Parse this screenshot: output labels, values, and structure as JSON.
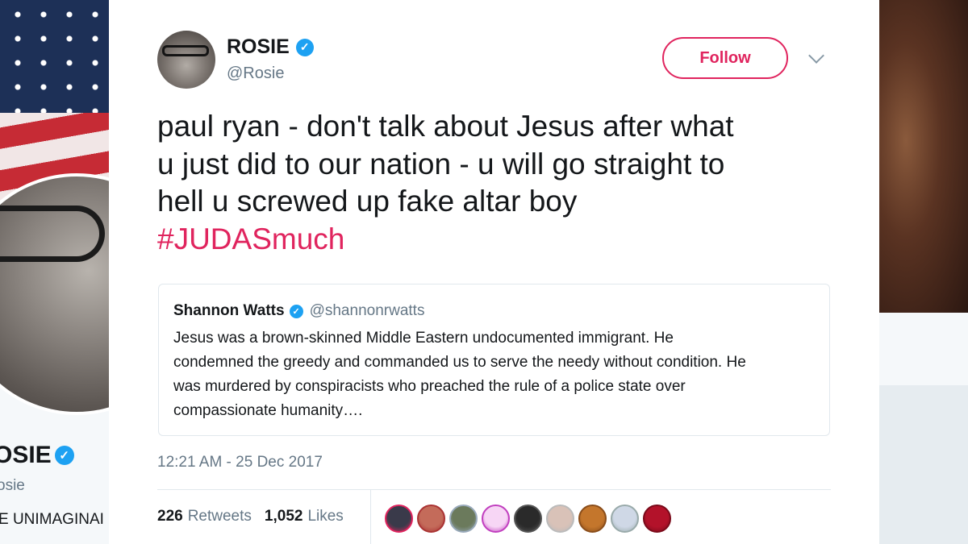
{
  "background_profile": {
    "name": "OSIE",
    "handle": "osie",
    "bio": "E UNIMAGINAI"
  },
  "tweet": {
    "author": {
      "name": "ROSIE",
      "handle": "@Rosie",
      "verified": true
    },
    "follow_label": "Follow",
    "text_lines": [
      "paul ryan - don't talk about Jesus after what",
      "u just did to our nation - u will go straight to",
      "hell u screwed up fake altar boy"
    ],
    "hashtag": "#JUDASmuch",
    "quoted": {
      "name": "Shannon Watts",
      "handle": "@shannonrwatts",
      "verified": true,
      "text_lines": [
        "Jesus was a brown-skinned Middle Eastern undocumented immigrant. He",
        "condemned the greedy and commanded us to serve the needy without condition. He",
        "was murdered by conspiracists who preached the rule of a police state over",
        "compassionate humanity…."
      ]
    },
    "timestamp": "12:21 AM - 25 Dec 2017",
    "retweets": {
      "count": "226",
      "label": "Retweets"
    },
    "likes": {
      "count": "1,052",
      "label": "Likes"
    },
    "likers": [
      {
        "name": "liker-avatar-1",
        "color": "#3a3a4a",
        "ring": "#e0245e"
      },
      {
        "name": "liker-avatar-2",
        "color": "#c46b5a",
        "ring": "#a33"
      },
      {
        "name": "liker-avatar-3",
        "color": "#6b7a5c",
        "ring": "#9ab"
      },
      {
        "name": "liker-avatar-4",
        "color": "#f7d6f5",
        "ring": "#c13fbf"
      },
      {
        "name": "liker-avatar-5",
        "color": "#2a2a2a",
        "ring": "#555"
      },
      {
        "name": "liker-avatar-6",
        "color": "#d9c2b8",
        "ring": "#bbb"
      },
      {
        "name": "liker-avatar-7",
        "color": "#c4762c",
        "ring": "#8a4d1a"
      },
      {
        "name": "liker-avatar-8",
        "color": "#cfd8e6",
        "ring": "#9aa"
      },
      {
        "name": "liker-avatar-9",
        "color": "#b3122a",
        "ring": "#7a0a1a"
      }
    ]
  },
  "colors": {
    "brand_pink": "#e0245e",
    "verified_blue": "#1da1f2",
    "secondary_text": "#657786"
  }
}
